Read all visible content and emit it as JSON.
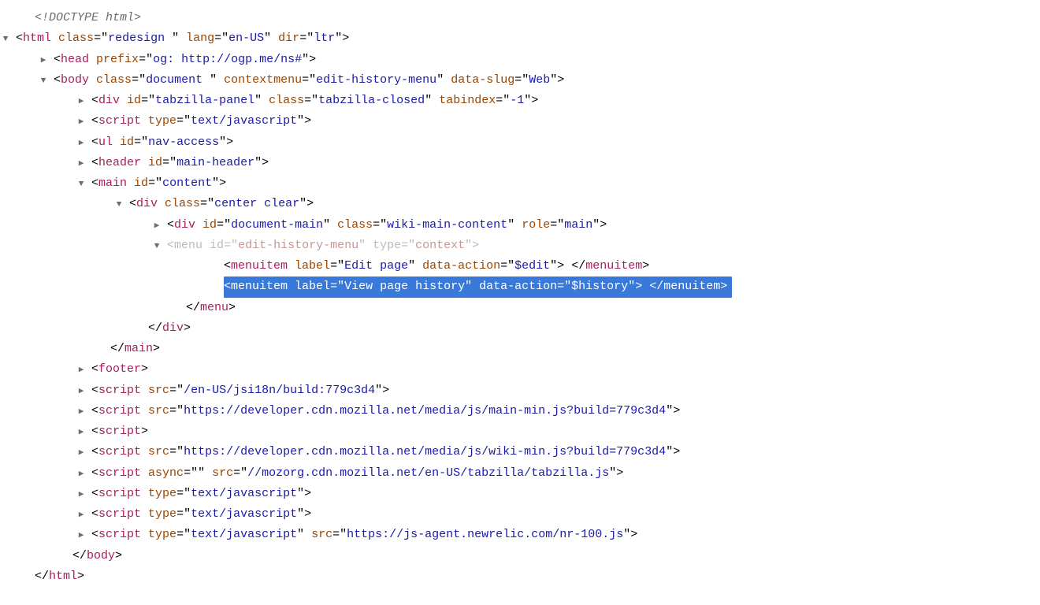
{
  "lines": [
    {
      "indent": 2,
      "arrow": "none",
      "faded": false,
      "selected": false,
      "parts": [
        {
          "cls": "doctype",
          "txt": "<!DOCTYPE html>"
        }
      ]
    },
    {
      "indent": 1,
      "arrow": "down",
      "faded": false,
      "selected": false,
      "parts": [
        {
          "cls": "punct",
          "txt": "<"
        },
        {
          "cls": "tag",
          "txt": "html"
        },
        {
          "cls": "punct",
          "txt": " "
        },
        {
          "cls": "attr",
          "txt": "class"
        },
        {
          "cls": "punct",
          "txt": "=\""
        },
        {
          "cls": "val",
          "txt": "redesign "
        },
        {
          "cls": "punct",
          "txt": "\" "
        },
        {
          "cls": "attr",
          "txt": "lang"
        },
        {
          "cls": "punct",
          "txt": "=\""
        },
        {
          "cls": "val",
          "txt": "en-US"
        },
        {
          "cls": "punct",
          "txt": "\" "
        },
        {
          "cls": "attr",
          "txt": "dir"
        },
        {
          "cls": "punct",
          "txt": "=\""
        },
        {
          "cls": "val",
          "txt": "ltr"
        },
        {
          "cls": "punct",
          "txt": "\">"
        }
      ]
    },
    {
      "indent": 3,
      "arrow": "right",
      "faded": false,
      "selected": false,
      "parts": [
        {
          "cls": "punct",
          "txt": "<"
        },
        {
          "cls": "tag",
          "txt": "head"
        },
        {
          "cls": "punct",
          "txt": " "
        },
        {
          "cls": "attr",
          "txt": "prefix"
        },
        {
          "cls": "punct",
          "txt": "=\""
        },
        {
          "cls": "val",
          "txt": "og: http://ogp.me/ns#"
        },
        {
          "cls": "punct",
          "txt": "\">"
        }
      ]
    },
    {
      "indent": 3,
      "arrow": "down",
      "faded": false,
      "selected": false,
      "parts": [
        {
          "cls": "punct",
          "txt": "<"
        },
        {
          "cls": "tag",
          "txt": "body"
        },
        {
          "cls": "punct",
          "txt": " "
        },
        {
          "cls": "attr",
          "txt": "class"
        },
        {
          "cls": "punct",
          "txt": "=\""
        },
        {
          "cls": "val",
          "txt": "document "
        },
        {
          "cls": "punct",
          "txt": "\" "
        },
        {
          "cls": "attr",
          "txt": "contextmenu"
        },
        {
          "cls": "punct",
          "txt": "=\""
        },
        {
          "cls": "val",
          "txt": "edit-history-menu"
        },
        {
          "cls": "punct",
          "txt": "\" "
        },
        {
          "cls": "attr",
          "txt": "data-slug"
        },
        {
          "cls": "punct",
          "txt": "=\""
        },
        {
          "cls": "val",
          "txt": "Web"
        },
        {
          "cls": "punct",
          "txt": "\">"
        }
      ]
    },
    {
      "indent": 5,
      "arrow": "right",
      "faded": false,
      "selected": false,
      "parts": [
        {
          "cls": "punct",
          "txt": "<"
        },
        {
          "cls": "tag",
          "txt": "div"
        },
        {
          "cls": "punct",
          "txt": " "
        },
        {
          "cls": "attr",
          "txt": "id"
        },
        {
          "cls": "punct",
          "txt": "=\""
        },
        {
          "cls": "val",
          "txt": "tabzilla-panel"
        },
        {
          "cls": "punct",
          "txt": "\" "
        },
        {
          "cls": "attr",
          "txt": "class"
        },
        {
          "cls": "punct",
          "txt": "=\""
        },
        {
          "cls": "val",
          "txt": "tabzilla-closed"
        },
        {
          "cls": "punct",
          "txt": "\" "
        },
        {
          "cls": "attr",
          "txt": "tabindex"
        },
        {
          "cls": "punct",
          "txt": "=\""
        },
        {
          "cls": "val",
          "txt": "-1"
        },
        {
          "cls": "punct",
          "txt": "\">"
        }
      ]
    },
    {
      "indent": 5,
      "arrow": "right",
      "faded": false,
      "selected": false,
      "parts": [
        {
          "cls": "punct",
          "txt": "<"
        },
        {
          "cls": "tag",
          "txt": "script"
        },
        {
          "cls": "punct",
          "txt": " "
        },
        {
          "cls": "attr",
          "txt": "type"
        },
        {
          "cls": "punct",
          "txt": "=\""
        },
        {
          "cls": "val",
          "txt": "text/javascript"
        },
        {
          "cls": "punct",
          "txt": "\">"
        }
      ]
    },
    {
      "indent": 5,
      "arrow": "right",
      "faded": false,
      "selected": false,
      "parts": [
        {
          "cls": "punct",
          "txt": "<"
        },
        {
          "cls": "tag",
          "txt": "ul"
        },
        {
          "cls": "punct",
          "txt": " "
        },
        {
          "cls": "attr",
          "txt": "id"
        },
        {
          "cls": "punct",
          "txt": "=\""
        },
        {
          "cls": "val",
          "txt": "nav-access"
        },
        {
          "cls": "punct",
          "txt": "\">"
        }
      ]
    },
    {
      "indent": 5,
      "arrow": "right",
      "faded": false,
      "selected": false,
      "parts": [
        {
          "cls": "punct",
          "txt": "<"
        },
        {
          "cls": "tag",
          "txt": "header"
        },
        {
          "cls": "punct",
          "txt": " "
        },
        {
          "cls": "attr",
          "txt": "id"
        },
        {
          "cls": "punct",
          "txt": "=\""
        },
        {
          "cls": "val",
          "txt": "main-header"
        },
        {
          "cls": "punct",
          "txt": "\">"
        }
      ]
    },
    {
      "indent": 5,
      "arrow": "down",
      "faded": false,
      "selected": false,
      "parts": [
        {
          "cls": "punct",
          "txt": "<"
        },
        {
          "cls": "tag",
          "txt": "main"
        },
        {
          "cls": "punct",
          "txt": " "
        },
        {
          "cls": "attr",
          "txt": "id"
        },
        {
          "cls": "punct",
          "txt": "=\""
        },
        {
          "cls": "val",
          "txt": "content"
        },
        {
          "cls": "punct",
          "txt": "\">"
        }
      ]
    },
    {
      "indent": 7,
      "arrow": "down",
      "faded": false,
      "selected": false,
      "parts": [
        {
          "cls": "punct",
          "txt": "<"
        },
        {
          "cls": "tag",
          "txt": "div"
        },
        {
          "cls": "punct",
          "txt": " "
        },
        {
          "cls": "attr",
          "txt": "class"
        },
        {
          "cls": "punct",
          "txt": "=\""
        },
        {
          "cls": "val",
          "txt": "center clear"
        },
        {
          "cls": "punct",
          "txt": "\">"
        }
      ]
    },
    {
      "indent": 9,
      "arrow": "right",
      "faded": false,
      "selected": false,
      "parts": [
        {
          "cls": "punct",
          "txt": "<"
        },
        {
          "cls": "tag",
          "txt": "div"
        },
        {
          "cls": "punct",
          "txt": " "
        },
        {
          "cls": "attr",
          "txt": "id"
        },
        {
          "cls": "punct",
          "txt": "=\""
        },
        {
          "cls": "val",
          "txt": "document-main"
        },
        {
          "cls": "punct",
          "txt": "\" "
        },
        {
          "cls": "attr",
          "txt": "class"
        },
        {
          "cls": "punct",
          "txt": "=\""
        },
        {
          "cls": "val",
          "txt": "wiki-main-content"
        },
        {
          "cls": "punct",
          "txt": "\" "
        },
        {
          "cls": "attr",
          "txt": "role"
        },
        {
          "cls": "punct",
          "txt": "=\""
        },
        {
          "cls": "val",
          "txt": "main"
        },
        {
          "cls": "punct",
          "txt": "\">"
        }
      ]
    },
    {
      "indent": 9,
      "arrow": "down",
      "faded": true,
      "selected": false,
      "parts": [
        {
          "cls": "punct",
          "txt": "<"
        },
        {
          "cls": "tag",
          "txt": "menu"
        },
        {
          "cls": "punct",
          "txt": " "
        },
        {
          "cls": "attr",
          "txt": "id"
        },
        {
          "cls": "punct",
          "txt": "=\""
        },
        {
          "cls": "val",
          "txt": "edit-history-menu"
        },
        {
          "cls": "punct",
          "txt": "\" "
        },
        {
          "cls": "attr",
          "txt": "type"
        },
        {
          "cls": "punct",
          "txt": "=\""
        },
        {
          "cls": "val",
          "txt": "context"
        },
        {
          "cls": "punct",
          "txt": "\">"
        }
      ]
    },
    {
      "indent": 12,
      "arrow": "none",
      "faded": false,
      "selected": false,
      "parts": [
        {
          "cls": "punct",
          "txt": "<"
        },
        {
          "cls": "tag",
          "txt": "menuitem"
        },
        {
          "cls": "punct",
          "txt": " "
        },
        {
          "cls": "attr",
          "txt": "label"
        },
        {
          "cls": "punct",
          "txt": "=\""
        },
        {
          "cls": "val",
          "txt": "Edit page"
        },
        {
          "cls": "punct",
          "txt": "\" "
        },
        {
          "cls": "attr",
          "txt": "data-action"
        },
        {
          "cls": "punct",
          "txt": "=\""
        },
        {
          "cls": "val",
          "txt": "$edit"
        },
        {
          "cls": "punct",
          "txt": "\">"
        },
        {
          "cls": "punct",
          "txt": " </"
        },
        {
          "cls": "tag",
          "txt": "menuitem"
        },
        {
          "cls": "punct",
          "txt": ">"
        }
      ]
    },
    {
      "indent": 12,
      "arrow": "none",
      "faded": false,
      "selected": true,
      "parts": [
        {
          "cls": "punct",
          "txt": "<"
        },
        {
          "cls": "tag",
          "txt": "menuitem"
        },
        {
          "cls": "punct",
          "txt": " "
        },
        {
          "cls": "attr",
          "txt": "label"
        },
        {
          "cls": "punct",
          "txt": "=\""
        },
        {
          "cls": "val",
          "txt": "View page history"
        },
        {
          "cls": "punct",
          "txt": "\" "
        },
        {
          "cls": "attr",
          "txt": "data-action"
        },
        {
          "cls": "punct",
          "txt": "=\""
        },
        {
          "cls": "val",
          "txt": "$history"
        },
        {
          "cls": "punct",
          "txt": "\">"
        },
        {
          "cls": "punct",
          "txt": " </"
        },
        {
          "cls": "tag",
          "txt": "menuitem"
        },
        {
          "cls": "punct",
          "txt": ">"
        }
      ]
    },
    {
      "indent": 10,
      "arrow": "none",
      "faded": false,
      "selected": false,
      "parts": [
        {
          "cls": "punct",
          "txt": "</"
        },
        {
          "cls": "tag",
          "txt": "menu"
        },
        {
          "cls": "punct",
          "txt": ">"
        }
      ]
    },
    {
      "indent": 8,
      "arrow": "none",
      "faded": false,
      "selected": false,
      "parts": [
        {
          "cls": "punct",
          "txt": "</"
        },
        {
          "cls": "tag",
          "txt": "div"
        },
        {
          "cls": "punct",
          "txt": ">"
        }
      ]
    },
    {
      "indent": 6,
      "arrow": "none",
      "faded": false,
      "selected": false,
      "parts": [
        {
          "cls": "punct",
          "txt": "</"
        },
        {
          "cls": "tag",
          "txt": "main"
        },
        {
          "cls": "punct",
          "txt": ">"
        }
      ]
    },
    {
      "indent": 5,
      "arrow": "right",
      "faded": false,
      "selected": false,
      "parts": [
        {
          "cls": "punct",
          "txt": "<"
        },
        {
          "cls": "tag",
          "txt": "footer"
        },
        {
          "cls": "punct",
          "txt": ">"
        }
      ]
    },
    {
      "indent": 5,
      "arrow": "right",
      "faded": false,
      "selected": false,
      "parts": [
        {
          "cls": "punct",
          "txt": "<"
        },
        {
          "cls": "tag",
          "txt": "script"
        },
        {
          "cls": "punct",
          "txt": " "
        },
        {
          "cls": "attr",
          "txt": "src"
        },
        {
          "cls": "punct",
          "txt": "=\""
        },
        {
          "cls": "val",
          "txt": "/en-US/jsi18n/build:779c3d4"
        },
        {
          "cls": "punct",
          "txt": "\">"
        }
      ]
    },
    {
      "indent": 5,
      "arrow": "right",
      "faded": false,
      "selected": false,
      "parts": [
        {
          "cls": "punct",
          "txt": "<"
        },
        {
          "cls": "tag",
          "txt": "script"
        },
        {
          "cls": "punct",
          "txt": " "
        },
        {
          "cls": "attr",
          "txt": "src"
        },
        {
          "cls": "punct",
          "txt": "=\""
        },
        {
          "cls": "val",
          "txt": "https://developer.cdn.mozilla.net/media/js/main-min.js?build=779c3d4"
        },
        {
          "cls": "punct",
          "txt": "\">"
        }
      ]
    },
    {
      "indent": 5,
      "arrow": "right",
      "faded": false,
      "selected": false,
      "parts": [
        {
          "cls": "punct",
          "txt": "<"
        },
        {
          "cls": "tag",
          "txt": "script"
        },
        {
          "cls": "punct",
          "txt": ">"
        }
      ]
    },
    {
      "indent": 5,
      "arrow": "right",
      "faded": false,
      "selected": false,
      "parts": [
        {
          "cls": "punct",
          "txt": "<"
        },
        {
          "cls": "tag",
          "txt": "script"
        },
        {
          "cls": "punct",
          "txt": " "
        },
        {
          "cls": "attr",
          "txt": "src"
        },
        {
          "cls": "punct",
          "txt": "=\""
        },
        {
          "cls": "val",
          "txt": "https://developer.cdn.mozilla.net/media/js/wiki-min.js?build=779c3d4"
        },
        {
          "cls": "punct",
          "txt": "\">"
        }
      ]
    },
    {
      "indent": 5,
      "arrow": "right",
      "faded": false,
      "selected": false,
      "parts": [
        {
          "cls": "punct",
          "txt": "<"
        },
        {
          "cls": "tag",
          "txt": "script"
        },
        {
          "cls": "punct",
          "txt": " "
        },
        {
          "cls": "attr",
          "txt": "async"
        },
        {
          "cls": "punct",
          "txt": "=\""
        },
        {
          "cls": "val",
          "txt": ""
        },
        {
          "cls": "punct",
          "txt": "\" "
        },
        {
          "cls": "attr",
          "txt": "src"
        },
        {
          "cls": "punct",
          "txt": "=\""
        },
        {
          "cls": "val",
          "txt": "//mozorg.cdn.mozilla.net/en-US/tabzilla/tabzilla.js"
        },
        {
          "cls": "punct",
          "txt": "\">"
        }
      ]
    },
    {
      "indent": 5,
      "arrow": "right",
      "faded": false,
      "selected": false,
      "parts": [
        {
          "cls": "punct",
          "txt": "<"
        },
        {
          "cls": "tag",
          "txt": "script"
        },
        {
          "cls": "punct",
          "txt": " "
        },
        {
          "cls": "attr",
          "txt": "type"
        },
        {
          "cls": "punct",
          "txt": "=\""
        },
        {
          "cls": "val",
          "txt": "text/javascript"
        },
        {
          "cls": "punct",
          "txt": "\">"
        }
      ]
    },
    {
      "indent": 5,
      "arrow": "right",
      "faded": false,
      "selected": false,
      "parts": [
        {
          "cls": "punct",
          "txt": "<"
        },
        {
          "cls": "tag",
          "txt": "script"
        },
        {
          "cls": "punct",
          "txt": " "
        },
        {
          "cls": "attr",
          "txt": "type"
        },
        {
          "cls": "punct",
          "txt": "=\""
        },
        {
          "cls": "val",
          "txt": "text/javascript"
        },
        {
          "cls": "punct",
          "txt": "\">"
        }
      ]
    },
    {
      "indent": 5,
      "arrow": "right",
      "faded": false,
      "selected": false,
      "parts": [
        {
          "cls": "punct",
          "txt": "<"
        },
        {
          "cls": "tag",
          "txt": "script"
        },
        {
          "cls": "punct",
          "txt": " "
        },
        {
          "cls": "attr",
          "txt": "type"
        },
        {
          "cls": "punct",
          "txt": "=\""
        },
        {
          "cls": "val",
          "txt": "text/javascript"
        },
        {
          "cls": "punct",
          "txt": "\" "
        },
        {
          "cls": "attr",
          "txt": "src"
        },
        {
          "cls": "punct",
          "txt": "=\""
        },
        {
          "cls": "val",
          "txt": "https://js-agent.newrelic.com/nr-100.js"
        },
        {
          "cls": "punct",
          "txt": "\">"
        }
      ]
    },
    {
      "indent": 4,
      "arrow": "none",
      "faded": false,
      "selected": false,
      "parts": [
        {
          "cls": "punct",
          "txt": "</"
        },
        {
          "cls": "tag",
          "txt": "body"
        },
        {
          "cls": "punct",
          "txt": ">"
        }
      ]
    },
    {
      "indent": 2,
      "arrow": "none",
      "faded": false,
      "selected": false,
      "parts": [
        {
          "cls": "punct",
          "txt": "</"
        },
        {
          "cls": "tag",
          "txt": "html"
        },
        {
          "cls": "punct",
          "txt": ">"
        }
      ]
    }
  ],
  "indentUnit": 24,
  "arrowGlyphs": {
    "down": "▼",
    "right": "▶",
    "none": "▶"
  }
}
